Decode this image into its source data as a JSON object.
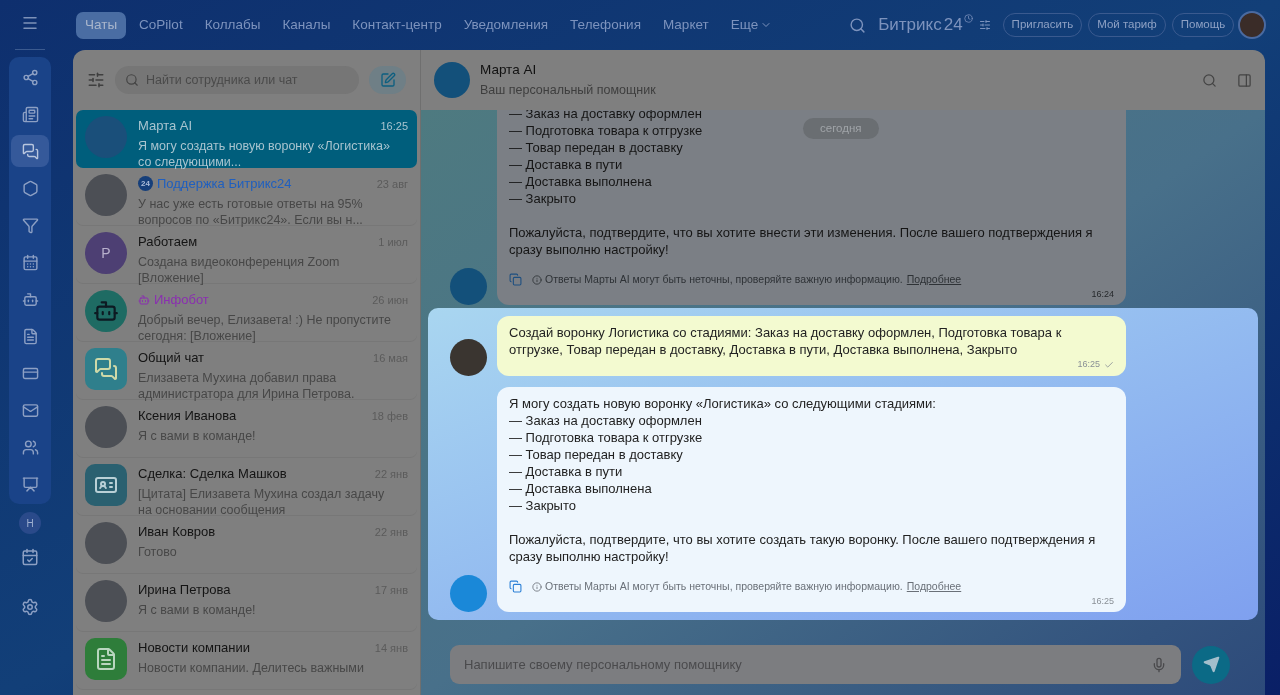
{
  "nav": {
    "tabs": [
      {
        "label": "Чаты",
        "selected": true
      },
      {
        "label": "CoPilot",
        "selected": false
      },
      {
        "label": "Коллабы",
        "selected": false
      },
      {
        "label": "Каналы",
        "selected": false
      },
      {
        "label": "Контакт-центр",
        "selected": false
      },
      {
        "label": "Уведомления",
        "selected": false
      },
      {
        "label": "Телефония",
        "selected": false
      },
      {
        "label": "Маркет",
        "selected": false
      },
      {
        "label": "Еще",
        "selected": false
      }
    ],
    "logo": "Битрикс",
    "logo_number": "24",
    "buttons": [
      "Пригласить",
      "Мой тариф",
      "Помощь"
    ]
  },
  "rail": {
    "items": [
      {
        "selected": false
      },
      {
        "selected": false
      },
      {
        "selected": true
      },
      {
        "selected": false
      },
      {
        "selected": false
      },
      {
        "selected": false
      },
      {
        "selected": false
      },
      {
        "selected": false
      },
      {
        "selected": false
      },
      {
        "selected": false
      },
      {
        "selected": false
      },
      {
        "selected": false
      }
    ],
    "user_initial": "Н"
  },
  "chat_list": {
    "search": {
      "placeholder": "Найти сотрудника или чат"
    },
    "chats": [
      {
        "kind": "photo",
        "name": "Марта AI",
        "time": "16:25",
        "preview": "Я могу создать новую воронку «Логистика» со следующими...",
        "selected": true
      },
      {
        "kind": "photo",
        "name": "Поддержка Битрикс24",
        "badge": "24",
        "color": "#1f5fbf",
        "time": "23 авг",
        "preview": "У нас уже есть готовые ответы на 95% вопросов по «Битрикс24». Если вы н...",
        "selected": false
      },
      {
        "kind": "letter",
        "name": "Работаем",
        "letter": "Р",
        "time": "1 июл",
        "preview": "Создана видеоконференция Zoom [Вложение]",
        "selected": false
      },
      {
        "kind": "bot",
        "name": "Инфобот",
        "color": "#8a2fb0",
        "time": "26 июн",
        "preview": "Добрый вечер, Елизавета! :) Не пропустите сегодня: [Вложение]",
        "selected": false
      },
      {
        "kind": "group",
        "name": "Общий чат",
        "time": "16 мая",
        "preview": "Елизавета Мухина добавил права администратора для Ирина Петрова.",
        "selected": false
      },
      {
        "kind": "photo",
        "name": "Ксения Иванова",
        "time": "18 фев",
        "preview": "Я с вами в команде!",
        "selected": false
      },
      {
        "kind": "deal",
        "name": "Сделка: Сделка Машков",
        "time": "22 янв",
        "preview": "[Цитата] Елизавета Мухина создал задачу на основании сообщения",
        "selected": false
      },
      {
        "kind": "photo",
        "name": "Иван Ковров",
        "time": "22 янв",
        "preview": "Готово",
        "selected": false
      },
      {
        "kind": "photo",
        "name": "Ирина Петрова",
        "time": "17 янв",
        "preview": "Я с вами в команде!",
        "selected": false
      },
      {
        "kind": "news",
        "name": "Новости компании",
        "time": "14 янв",
        "preview": "Новости компании. Делитесь важными",
        "selected": false
      }
    ]
  },
  "chat": {
    "title": "Марта AI",
    "subtitle": "Ваш персональный помощник",
    "date_badge": "сегодня",
    "messages": [
      {
        "kind": "bot",
        "highlighted": false,
        "stages": [
          "— Заказ на доставку оформлен",
          "— Подготовка товара к отгрузке",
          "— Товар передан в доставку",
          "— Доставка в пути",
          "— Доставка выполнена",
          "— Закрыто"
        ],
        "closing": "Пожалуйста, подтвердите, что вы хотите внести эти изменения. После вашего подтверждения я сразу выполню настройку!",
        "disclaimer": "Ответы Марты AI могут быть неточны, проверяйте важную информацию.",
        "link": "Подробнее",
        "time": "16:24"
      },
      {
        "kind": "user",
        "highlighted": true,
        "text": "Создай воронку Логистика со стадиями: Заказ на доставку оформлен, Подготовка товара к отгрузке, Товар передан в доставку, Доставка в пути, Доставка выполнена, Закрыто",
        "time": "16:25",
        "read": true
      },
      {
        "kind": "bot",
        "highlighted": true,
        "text": "Я могу создать новую воронку «Логистика» со следующими стадиями:",
        "stages": [
          "— Заказ на доставку оформлен",
          "— Подготовка товара к отгрузке",
          "— Товар передан в доставку",
          "— Доставка в пути",
          "— Доставка выполнена",
          "— Закрыто"
        ],
        "closing": "Пожалуйста, подтвердите, что вы хотите создать такую воронку. После вашего подтверждения я сразу выполню настройку!",
        "disclaimer": "Ответы Марты AI могут быть неточны, проверяйте важную информацию.",
        "link": "Подробнее",
        "time": "16:25"
      }
    ],
    "input": {
      "placeholder": "Напишите своему персональному помощнику"
    }
  }
}
